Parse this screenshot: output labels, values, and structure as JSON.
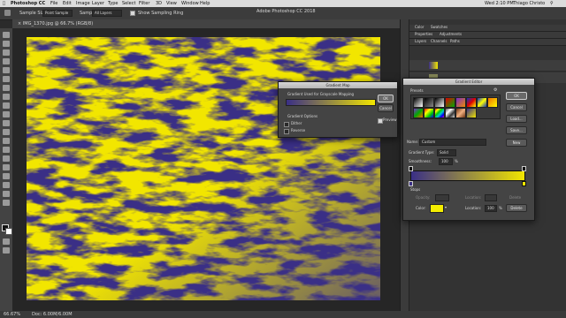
{
  "menu": {
    "app": "Photoshop CC",
    "items": [
      "File",
      "Edit",
      "Image",
      "Layer",
      "Type",
      "Select",
      "Filter",
      "3D",
      "View",
      "Window",
      "Help"
    ],
    "status_right": "Wed 2:10 PM",
    "user": "Thiago Christo"
  },
  "options": {
    "sample_size": "Sample Size:",
    "sample_value": "Point Sample",
    "sample_label": "Sample:",
    "layers_value": "All Layers",
    "show_ring": "Show Sampling Ring"
  },
  "window_title": "Adobe Photoshop CC 2018",
  "document_tab": "× IMG_1370.jpg @ 66.7% (RGB/8)",
  "status": {
    "zoom": "66.67%",
    "doc": "Doc: 6.00M/6.00M"
  },
  "panels": {
    "top_tabs": [
      "Color",
      "Swatches"
    ],
    "mid_tabs": [
      "Properties",
      "Adjustments"
    ],
    "layer_tabs": [
      "Layers",
      "Channels",
      "Paths"
    ]
  },
  "gradient_map": {
    "title": "Gradient Map",
    "section_label": "Gradient Used for Grayscale Mapping",
    "ok": "OK",
    "cancel": "Cancel",
    "preview": "Preview",
    "options_label": "Gradient Options",
    "dither": "Dither",
    "reverse": "Reverse",
    "preview_checked": true
  },
  "gradient_editor": {
    "title": "Gradient Editor",
    "presets_label": "Presets",
    "ok": "OK",
    "cancel": "Cancel",
    "load": "Load...",
    "save": "Save...",
    "name_label": "Name:",
    "name_value": "Custom",
    "new": "New",
    "type_label": "Gradient Type:",
    "type_value": "Solid",
    "smooth_label": "Smoothness:",
    "smooth_value": "100",
    "smooth_unit": "%",
    "stops_label": "Stops",
    "opacity_label": "Opacity:",
    "location_label": "Location:",
    "delete": "Delete",
    "color_label": "Color:",
    "location_value": "100",
    "pct": "%",
    "stop_color": "#f5ee00"
  },
  "colors": {
    "yellow": "#f2e600",
    "navy": "#3a2f86",
    "accent": "#2a6fd6"
  }
}
